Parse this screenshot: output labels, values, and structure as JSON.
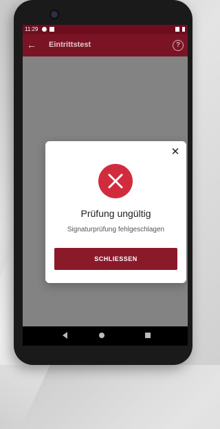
{
  "statusbar": {
    "time": "11:29"
  },
  "appbar": {
    "title": "Eintrittstest"
  },
  "dialog": {
    "title": "Prüfung ungültig",
    "message": "Signaturprüfung fehlgeschlagen",
    "close_button_label": "SCHLIESSEN"
  },
  "colors": {
    "statusbar": "#6e0d1e",
    "appbar": "#7a1424",
    "error_icon": "#d12c3d",
    "button": "#8a1a2a"
  },
  "icons": [
    "back-arrow-icon",
    "help-icon",
    "close-icon",
    "error-x-icon"
  ]
}
